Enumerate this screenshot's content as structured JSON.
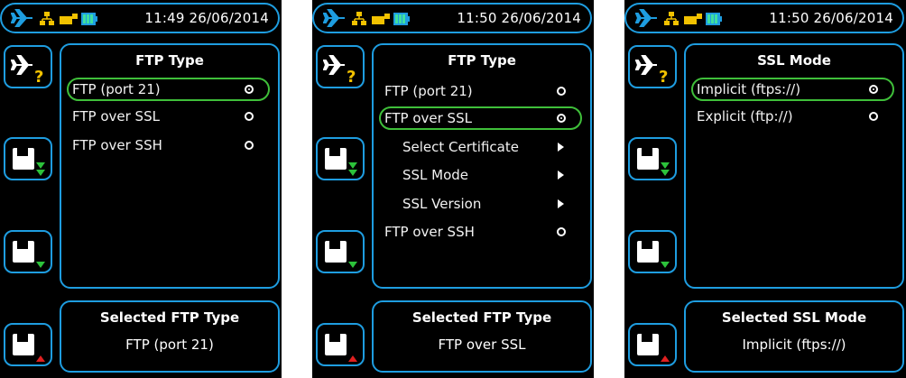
{
  "colors": {
    "accent": "#1e9de0",
    "selected": "#3fbf3a",
    "status_yellow": "#f2c200",
    "save_green": "#2cc23a",
    "save_red": "#e02020"
  },
  "status_icons": [
    "plane-icon",
    "network-icon",
    "usb-icon",
    "battery-icon"
  ],
  "side_buttons": [
    "help-icon",
    "save-all-icon",
    "save-down-icon",
    "save-up-icon"
  ],
  "screens": [
    {
      "time": "11:49 26/06/2014",
      "title": "FTP Type",
      "options": [
        {
          "label": "FTP (port 21)",
          "kind": "radio",
          "checked": true,
          "highlighted": true
        },
        {
          "label": "FTP over SSL",
          "kind": "radio",
          "checked": false
        },
        {
          "label": "FTP over SSH",
          "kind": "radio",
          "checked": false
        }
      ],
      "bottom_title": "Selected FTP Type",
      "bottom_value": "FTP (port 21)"
    },
    {
      "time": "11:50 26/06/2014",
      "title": "FTP Type",
      "options": [
        {
          "label": "FTP (port 21)",
          "kind": "radio",
          "checked": false
        },
        {
          "label": "FTP over SSL",
          "kind": "radio",
          "checked": true,
          "highlighted": true
        },
        {
          "label": "Select Certificate",
          "kind": "submenu"
        },
        {
          "label": "SSL Mode",
          "kind": "submenu"
        },
        {
          "label": "SSL Version",
          "kind": "submenu"
        },
        {
          "label": "FTP over SSH",
          "kind": "radio",
          "checked": false
        }
      ],
      "bottom_title": "Selected FTP Type",
      "bottom_value": "FTP over SSL"
    },
    {
      "time": "11:50 26/06/2014",
      "title": "SSL Mode",
      "options": [
        {
          "label": "Implicit (ftps://)",
          "kind": "radio",
          "checked": true,
          "highlighted": true
        },
        {
          "label": "Explicit (ftp://)",
          "kind": "radio",
          "checked": false
        }
      ],
      "bottom_title": "Selected SSL Mode",
      "bottom_value": "Implicit (ftps://)"
    }
  ]
}
